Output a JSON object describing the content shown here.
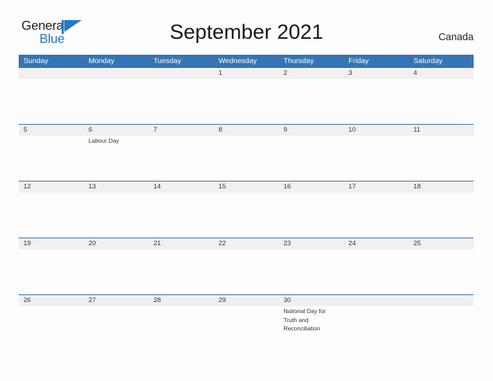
{
  "header": {
    "logo": {
      "name": "General Blue",
      "word_1": "General",
      "word_2": "Blue",
      "flag_icon": "blue-triangle-flag-icon",
      "word_1_color": "#231f20",
      "word_2_color": "#1f7ac6",
      "flag_color": "#1f7ac6"
    },
    "month_title": "September 2021",
    "country": "Canada"
  },
  "theme": {
    "header_blue": "#3575b4",
    "row_rule_blue": "#2b6ca8",
    "date_band_gray": "#f0f0f0",
    "page_background": "#fdfdfd",
    "text_color": "#333333"
  },
  "calendar": {
    "weekdays": [
      "Sunday",
      "Monday",
      "Tuesday",
      "Wednesday",
      "Thursday",
      "Friday",
      "Saturday"
    ],
    "weeks": [
      {
        "days": [
          {
            "number": "",
            "event": ""
          },
          {
            "number": "",
            "event": ""
          },
          {
            "number": "",
            "event": ""
          },
          {
            "number": "1",
            "event": ""
          },
          {
            "number": "2",
            "event": ""
          },
          {
            "number": "3",
            "event": ""
          },
          {
            "number": "4",
            "event": ""
          }
        ]
      },
      {
        "days": [
          {
            "number": "5",
            "event": ""
          },
          {
            "number": "6",
            "event": "Labour Day"
          },
          {
            "number": "7",
            "event": ""
          },
          {
            "number": "8",
            "event": ""
          },
          {
            "number": "9",
            "event": ""
          },
          {
            "number": "10",
            "event": ""
          },
          {
            "number": "11",
            "event": ""
          }
        ]
      },
      {
        "days": [
          {
            "number": "12",
            "event": ""
          },
          {
            "number": "13",
            "event": ""
          },
          {
            "number": "14",
            "event": ""
          },
          {
            "number": "15",
            "event": ""
          },
          {
            "number": "16",
            "event": ""
          },
          {
            "number": "17",
            "event": ""
          },
          {
            "number": "18",
            "event": ""
          }
        ]
      },
      {
        "days": [
          {
            "number": "19",
            "event": ""
          },
          {
            "number": "20",
            "event": ""
          },
          {
            "number": "21",
            "event": ""
          },
          {
            "number": "22",
            "event": ""
          },
          {
            "number": "23",
            "event": ""
          },
          {
            "number": "24",
            "event": ""
          },
          {
            "number": "25",
            "event": ""
          }
        ]
      },
      {
        "days": [
          {
            "number": "26",
            "event": ""
          },
          {
            "number": "27",
            "event": ""
          },
          {
            "number": "28",
            "event": ""
          },
          {
            "number": "29",
            "event": ""
          },
          {
            "number": "30",
            "event": "National Day for Truth and Reconciliation"
          },
          {
            "number": "",
            "event": ""
          },
          {
            "number": "",
            "event": ""
          }
        ]
      }
    ]
  }
}
